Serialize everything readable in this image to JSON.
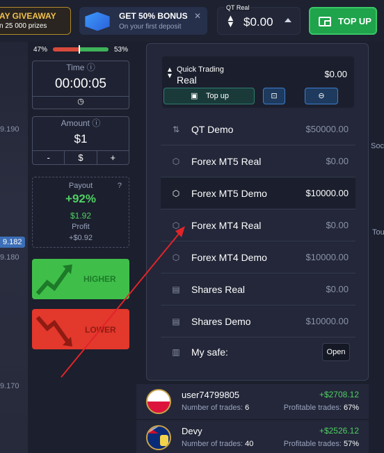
{
  "header": {
    "giveaway_title": "AY GIVEAWAY",
    "giveaway_sub": "n 25 000 prizes",
    "bonus_title": "GET 50% BONUS",
    "bonus_sub": "On your first deposit",
    "bonus_close": "✕",
    "account_label": "QT Real",
    "account_value": "$0.00",
    "topup_label": "TOP UP"
  },
  "prices": [
    "9.190",
    "9.182",
    "9.180",
    "9.170"
  ],
  "sentiment": {
    "left": "47%",
    "right": "53%",
    "left_fraction": 0.47
  },
  "time": {
    "label": "Time ⓘ",
    "value": "00:00:05"
  },
  "amount": {
    "label": "Amount ⓘ",
    "value": "$1",
    "minus": "-",
    "currency": "$",
    "plus": "+"
  },
  "payout": {
    "label": "Payout",
    "help": "?",
    "percent": "+92%",
    "amount": "$1.92",
    "profit_label": "Profit",
    "profit": "+$0.92"
  },
  "higher_label": "HIGHER",
  "lower_label": "LOWER",
  "quick_trading": {
    "line1": "Quick Trading",
    "line2": "Real",
    "balance": "$0.00",
    "topup": "Top up"
  },
  "accounts": [
    {
      "name": "QT Demo",
      "balance": "$50000.00"
    },
    {
      "name": "Forex MT5 Real",
      "balance": "$0.00"
    },
    {
      "name": "Forex MT5 Demo",
      "balance": "$10000.00"
    },
    {
      "name": "Forex MT4 Real",
      "balance": "$0.00"
    },
    {
      "name": "Forex MT4 Demo",
      "balance": "$10000.00"
    },
    {
      "name": "Shares Real",
      "balance": "$0.00"
    },
    {
      "name": "Shares Demo",
      "balance": "$10000.00"
    }
  ],
  "safe": {
    "label": "My safe:",
    "button": "Open"
  },
  "leaderboard": [
    {
      "user": "user74799805",
      "trades_label": "Number of trades:",
      "trades": "6",
      "profit": "+$2708.12",
      "pt_label": "Profitable trades:",
      "pt": "67%"
    },
    {
      "user": "Devy",
      "trades_label": "Number of trades:",
      "trades": "40",
      "profit": "+$2526.12",
      "pt_label": "Profitable trades:",
      "pt": "57%"
    }
  ],
  "side_labels": [
    "Soc",
    "Tou"
  ],
  "colors": {
    "green": "#3fbf4a",
    "red": "#e3382c",
    "accent_blue": "#3c7fd0",
    "arrow": "#e0242a"
  }
}
